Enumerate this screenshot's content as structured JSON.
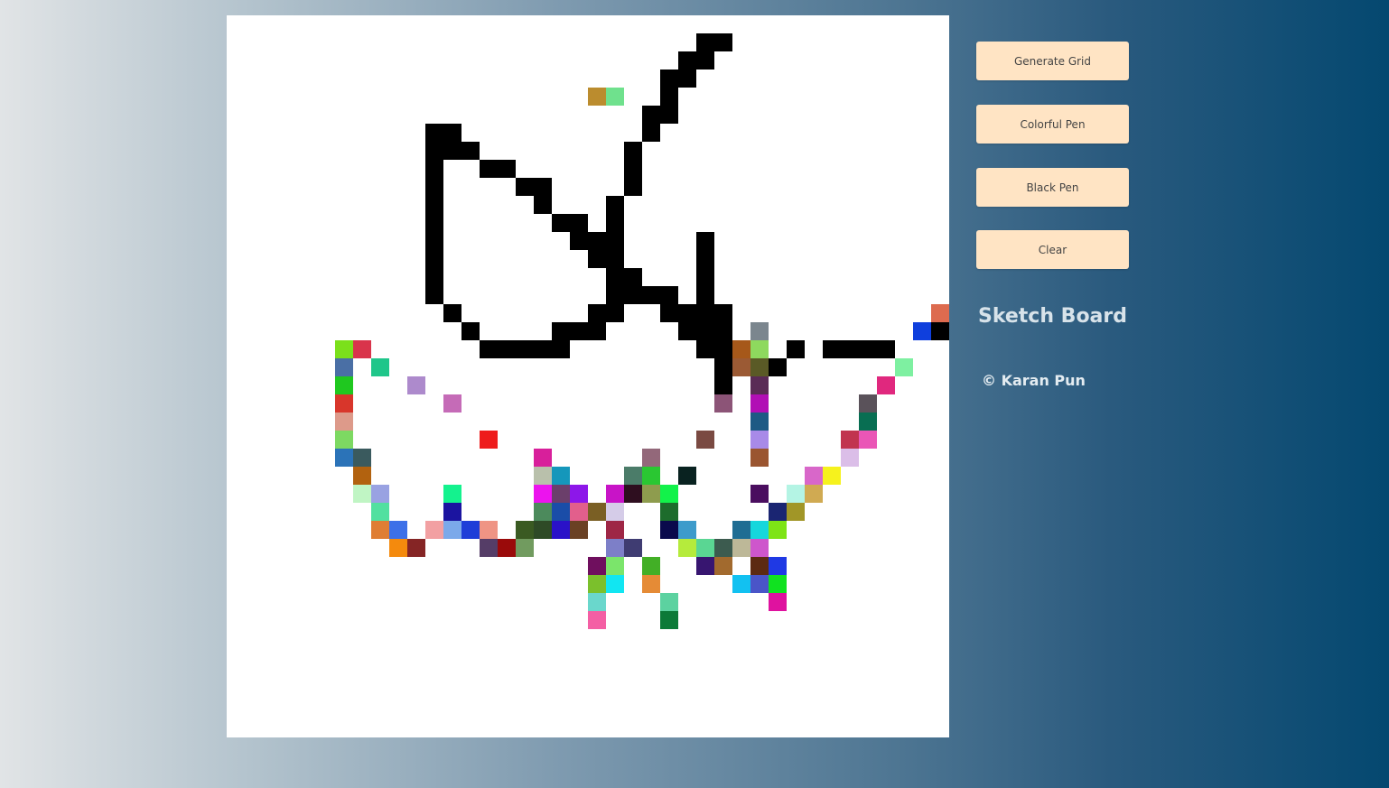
{
  "controls": {
    "generate_grid": "Generate Grid",
    "colorful_pen": "Colorful Pen",
    "black_pen": "Black Pen",
    "clear": "Clear"
  },
  "app": {
    "title": "Sketch Board",
    "credit": "© Karan Pun"
  },
  "board": {
    "background": "#ffffff",
    "grid_columns": 40,
    "grid_rows": 40,
    "black_pen_color": "#000000",
    "painted_cells": [
      {
        "r": 1,
        "c": 26,
        "color": "#000000"
      },
      {
        "r": 1,
        "c": 27,
        "color": "#000000"
      },
      {
        "r": 2,
        "c": 25,
        "color": "#000000"
      },
      {
        "r": 2,
        "c": 26,
        "color": "#000000"
      },
      {
        "r": 3,
        "c": 24,
        "color": "#000000"
      },
      {
        "r": 3,
        "c": 25,
        "color": "#000000"
      },
      {
        "r": 4,
        "c": 20,
        "color": "#bb8c2e"
      },
      {
        "r": 4,
        "c": 21,
        "color": "#6fe18d"
      },
      {
        "r": 4,
        "c": 24,
        "color": "#000000"
      },
      {
        "r": 5,
        "c": 23,
        "color": "#000000"
      },
      {
        "r": 5,
        "c": 24,
        "color": "#000000"
      },
      {
        "r": 6,
        "c": 11,
        "color": "#000000"
      },
      {
        "r": 6,
        "c": 12,
        "color": "#000000"
      },
      {
        "r": 6,
        "c": 23,
        "color": "#000000"
      },
      {
        "r": 7,
        "c": 11,
        "color": "#000000"
      },
      {
        "r": 7,
        "c": 12,
        "color": "#000000"
      },
      {
        "r": 7,
        "c": 13,
        "color": "#000000"
      },
      {
        "r": 7,
        "c": 22,
        "color": "#000000"
      },
      {
        "r": 8,
        "c": 11,
        "color": "#000000"
      },
      {
        "r": 8,
        "c": 14,
        "color": "#000000"
      },
      {
        "r": 8,
        "c": 15,
        "color": "#000000"
      },
      {
        "r": 8,
        "c": 22,
        "color": "#000000"
      },
      {
        "r": 9,
        "c": 11,
        "color": "#000000"
      },
      {
        "r": 9,
        "c": 16,
        "color": "#000000"
      },
      {
        "r": 9,
        "c": 17,
        "color": "#000000"
      },
      {
        "r": 9,
        "c": 22,
        "color": "#000000"
      },
      {
        "r": 10,
        "c": 11,
        "color": "#000000"
      },
      {
        "r": 10,
        "c": 17,
        "color": "#000000"
      },
      {
        "r": 10,
        "c": 21,
        "color": "#000000"
      },
      {
        "r": 11,
        "c": 11,
        "color": "#000000"
      },
      {
        "r": 11,
        "c": 18,
        "color": "#000000"
      },
      {
        "r": 11,
        "c": 19,
        "color": "#000000"
      },
      {
        "r": 11,
        "c": 21,
        "color": "#000000"
      },
      {
        "r": 12,
        "c": 11,
        "color": "#000000"
      },
      {
        "r": 12,
        "c": 19,
        "color": "#000000"
      },
      {
        "r": 12,
        "c": 20,
        "color": "#000000"
      },
      {
        "r": 12,
        "c": 21,
        "color": "#000000"
      },
      {
        "r": 12,
        "c": 26,
        "color": "#000000"
      },
      {
        "r": 13,
        "c": 11,
        "color": "#000000"
      },
      {
        "r": 13,
        "c": 20,
        "color": "#000000"
      },
      {
        "r": 13,
        "c": 21,
        "color": "#000000"
      },
      {
        "r": 13,
        "c": 26,
        "color": "#000000"
      },
      {
        "r": 14,
        "c": 11,
        "color": "#000000"
      },
      {
        "r": 14,
        "c": 21,
        "color": "#000000"
      },
      {
        "r": 14,
        "c": 22,
        "color": "#000000"
      },
      {
        "r": 14,
        "c": 26,
        "color": "#000000"
      },
      {
        "r": 15,
        "c": 11,
        "color": "#000000"
      },
      {
        "r": 15,
        "c": 21,
        "color": "#000000"
      },
      {
        "r": 15,
        "c": 22,
        "color": "#000000"
      },
      {
        "r": 15,
        "c": 23,
        "color": "#000000"
      },
      {
        "r": 15,
        "c": 24,
        "color": "#000000"
      },
      {
        "r": 15,
        "c": 26,
        "color": "#000000"
      },
      {
        "r": 16,
        "c": 12,
        "color": "#000000"
      },
      {
        "r": 16,
        "c": 20,
        "color": "#000000"
      },
      {
        "r": 16,
        "c": 21,
        "color": "#000000"
      },
      {
        "r": 16,
        "c": 24,
        "color": "#000000"
      },
      {
        "r": 16,
        "c": 25,
        "color": "#000000"
      },
      {
        "r": 16,
        "c": 26,
        "color": "#000000"
      },
      {
        "r": 16,
        "c": 27,
        "color": "#000000"
      },
      {
        "r": 16,
        "c": 39,
        "color": "#dd6b4f"
      },
      {
        "r": 17,
        "c": 13,
        "color": "#000000"
      },
      {
        "r": 17,
        "c": 18,
        "color": "#000000"
      },
      {
        "r": 17,
        "c": 19,
        "color": "#000000"
      },
      {
        "r": 17,
        "c": 20,
        "color": "#000000"
      },
      {
        "r": 17,
        "c": 25,
        "color": "#000000"
      },
      {
        "r": 17,
        "c": 26,
        "color": "#000000"
      },
      {
        "r": 17,
        "c": 27,
        "color": "#000000"
      },
      {
        "r": 17,
        "c": 29,
        "color": "#7b868e"
      },
      {
        "r": 17,
        "c": 38,
        "color": "#0f3fdd"
      },
      {
        "r": 17,
        "c": 39,
        "color": "#000000"
      },
      {
        "r": 18,
        "c": 6,
        "color": "#7be01b"
      },
      {
        "r": 18,
        "c": 7,
        "color": "#d9344b"
      },
      {
        "r": 18,
        "c": 14,
        "color": "#000000"
      },
      {
        "r": 18,
        "c": 15,
        "color": "#000000"
      },
      {
        "r": 18,
        "c": 16,
        "color": "#000000"
      },
      {
        "r": 18,
        "c": 17,
        "color": "#000000"
      },
      {
        "r": 18,
        "c": 18,
        "color": "#000000"
      },
      {
        "r": 18,
        "c": 26,
        "color": "#000000"
      },
      {
        "r": 18,
        "c": 27,
        "color": "#000000"
      },
      {
        "r": 18,
        "c": 28,
        "color": "#a6581a"
      },
      {
        "r": 18,
        "c": 29,
        "color": "#8ed95e"
      },
      {
        "r": 18,
        "c": 31,
        "color": "#000000"
      },
      {
        "r": 18,
        "c": 33,
        "color": "#000000"
      },
      {
        "r": 18,
        "c": 34,
        "color": "#000000"
      },
      {
        "r": 18,
        "c": 35,
        "color": "#000000"
      },
      {
        "r": 18,
        "c": 36,
        "color": "#000000"
      },
      {
        "r": 19,
        "c": 6,
        "color": "#4a6fa5"
      },
      {
        "r": 19,
        "c": 8,
        "color": "#1fc68a"
      },
      {
        "r": 19,
        "c": 27,
        "color": "#000000"
      },
      {
        "r": 19,
        "c": 28,
        "color": "#9b5a34"
      },
      {
        "r": 19,
        "c": 29,
        "color": "#5a5a26"
      },
      {
        "r": 19,
        "c": 30,
        "color": "#000000"
      },
      {
        "r": 19,
        "c": 37,
        "color": "#7ef0a1"
      },
      {
        "r": 20,
        "c": 6,
        "color": "#1fc81f"
      },
      {
        "r": 20,
        "c": 10,
        "color": "#ad8acc"
      },
      {
        "r": 20,
        "c": 27,
        "color": "#000000"
      },
      {
        "r": 20,
        "c": 29,
        "color": "#5a2c56"
      },
      {
        "r": 20,
        "c": 36,
        "color": "#e0287e"
      },
      {
        "r": 21,
        "c": 6,
        "color": "#d8362b"
      },
      {
        "r": 21,
        "c": 12,
        "color": "#c56bb7"
      },
      {
        "r": 21,
        "c": 27,
        "color": "#8c5477"
      },
      {
        "r": 21,
        "c": 29,
        "color": "#b10fb5"
      },
      {
        "r": 21,
        "c": 35,
        "color": "#5a525a"
      },
      {
        "r": 22,
        "c": 6,
        "color": "#dd9a8a"
      },
      {
        "r": 22,
        "c": 29,
        "color": "#1d5a84"
      },
      {
        "r": 22,
        "c": 35,
        "color": "#086e52"
      },
      {
        "r": 23,
        "c": 6,
        "color": "#7dd962"
      },
      {
        "r": 23,
        "c": 14,
        "color": "#ee1c1c"
      },
      {
        "r": 23,
        "c": 26,
        "color": "#7a4a42"
      },
      {
        "r": 23,
        "c": 29,
        "color": "#a88ae8"
      },
      {
        "r": 23,
        "c": 34,
        "color": "#c1344f"
      },
      {
        "r": 23,
        "c": 35,
        "color": "#ea56b6"
      },
      {
        "r": 24,
        "c": 6,
        "color": "#2b73b8"
      },
      {
        "r": 24,
        "c": 7,
        "color": "#3a5a5e"
      },
      {
        "r": 24,
        "c": 17,
        "color": "#d81f9b"
      },
      {
        "r": 24,
        "c": 23,
        "color": "#93687a"
      },
      {
        "r": 24,
        "c": 29,
        "color": "#9a5530"
      },
      {
        "r": 24,
        "c": 34,
        "color": "#dbbee8"
      },
      {
        "r": 25,
        "c": 7,
        "color": "#b2620f"
      },
      {
        "r": 25,
        "c": 17,
        "color": "#b9c0ab"
      },
      {
        "r": 25,
        "c": 18,
        "color": "#1597bb"
      },
      {
        "r": 25,
        "c": 22,
        "color": "#4b7c69"
      },
      {
        "r": 25,
        "c": 23,
        "color": "#2ac732"
      },
      {
        "r": 25,
        "c": 25,
        "color": "#092220"
      },
      {
        "r": 25,
        "c": 32,
        "color": "#d867c9"
      },
      {
        "r": 25,
        "c": 33,
        "color": "#f6f21d"
      },
      {
        "r": 26,
        "c": 7,
        "color": "#c0f5c4"
      },
      {
        "r": 26,
        "c": 8,
        "color": "#99a2e2"
      },
      {
        "r": 26,
        "c": 12,
        "color": "#14f28e"
      },
      {
        "r": 26,
        "c": 17,
        "color": "#ec13ee"
      },
      {
        "r": 26,
        "c": 18,
        "color": "#6b3f6b"
      },
      {
        "r": 26,
        "c": 19,
        "color": "#8d17e9"
      },
      {
        "r": 26,
        "c": 21,
        "color": "#c814c7"
      },
      {
        "r": 26,
        "c": 22,
        "color": "#2e0e1f"
      },
      {
        "r": 26,
        "c": 23,
        "color": "#8e9c4e"
      },
      {
        "r": 26,
        "c": 24,
        "color": "#12f24a"
      },
      {
        "r": 26,
        "c": 29,
        "color": "#4a0e5f"
      },
      {
        "r": 26,
        "c": 31,
        "color": "#b4f4e4"
      },
      {
        "r": 26,
        "c": 32,
        "color": "#d0aa52"
      },
      {
        "r": 27,
        "c": 8,
        "color": "#52e0a0"
      },
      {
        "r": 27,
        "c": 12,
        "color": "#1b14a0"
      },
      {
        "r": 27,
        "c": 17,
        "color": "#4c8a5c"
      },
      {
        "r": 27,
        "c": 18,
        "color": "#1a4da8"
      },
      {
        "r": 27,
        "c": 19,
        "color": "#e25f8c"
      },
      {
        "r": 27,
        "c": 20,
        "color": "#7a5f24"
      },
      {
        "r": 27,
        "c": 21,
        "color": "#d5cce8"
      },
      {
        "r": 27,
        "c": 24,
        "color": "#1d6c2c"
      },
      {
        "r": 27,
        "c": 30,
        "color": "#1a2572"
      },
      {
        "r": 27,
        "c": 31,
        "color": "#a19627"
      },
      {
        "r": 28,
        "c": 8,
        "color": "#df7e34"
      },
      {
        "r": 28,
        "c": 9,
        "color": "#3d70e8"
      },
      {
        "r": 28,
        "c": 11,
        "color": "#f2a0a2"
      },
      {
        "r": 28,
        "c": 12,
        "color": "#7ba9ea"
      },
      {
        "r": 28,
        "c": 13,
        "color": "#1f3ed8"
      },
      {
        "r": 28,
        "c": 14,
        "color": "#ef9484"
      },
      {
        "r": 28,
        "c": 16,
        "color": "#3a5a22"
      },
      {
        "r": 28,
        "c": 17,
        "color": "#2e4a26"
      },
      {
        "r": 28,
        "c": 18,
        "color": "#2a12c8"
      },
      {
        "r": 28,
        "c": 19,
        "color": "#6a4124"
      },
      {
        "r": 28,
        "c": 21,
        "color": "#9e2645"
      },
      {
        "r": 28,
        "c": 24,
        "color": "#0a0a4c"
      },
      {
        "r": 28,
        "c": 25,
        "color": "#3d9bcb"
      },
      {
        "r": 28,
        "c": 28,
        "color": "#1f6d93"
      },
      {
        "r": 28,
        "c": 29,
        "color": "#16d7dc"
      },
      {
        "r": 28,
        "c": 30,
        "color": "#7ee416"
      },
      {
        "r": 29,
        "c": 9,
        "color": "#f48a0d"
      },
      {
        "r": 29,
        "c": 10,
        "color": "#852525"
      },
      {
        "r": 29,
        "c": 14,
        "color": "#553d67"
      },
      {
        "r": 29,
        "c": 15,
        "color": "#9a0a0a"
      },
      {
        "r": 29,
        "c": 16,
        "color": "#719b5f"
      },
      {
        "r": 29,
        "c": 21,
        "color": "#7d7fc8"
      },
      {
        "r": 29,
        "c": 22,
        "color": "#3f3c72"
      },
      {
        "r": 29,
        "c": 25,
        "color": "#b5eb3c"
      },
      {
        "r": 29,
        "c": 26,
        "color": "#5ad693"
      },
      {
        "r": 29,
        "c": 27,
        "color": "#3c5b4f"
      },
      {
        "r": 29,
        "c": 28,
        "color": "#bdb898"
      },
      {
        "r": 29,
        "c": 29,
        "color": "#ce56cc"
      },
      {
        "r": 30,
        "c": 20,
        "color": "#6f0f5e"
      },
      {
        "r": 30,
        "c": 21,
        "color": "#7be56b"
      },
      {
        "r": 30,
        "c": 23,
        "color": "#42af26"
      },
      {
        "r": 30,
        "c": 26,
        "color": "#371570"
      },
      {
        "r": 30,
        "c": 27,
        "color": "#a26a2e"
      },
      {
        "r": 30,
        "c": 29,
        "color": "#5c2a12"
      },
      {
        "r": 30,
        "c": 30,
        "color": "#1f39e4"
      },
      {
        "r": 31,
        "c": 20,
        "color": "#7bc02c"
      },
      {
        "r": 31,
        "c": 21,
        "color": "#11e6f2"
      },
      {
        "r": 31,
        "c": 23,
        "color": "#e58b36"
      },
      {
        "r": 31,
        "c": 28,
        "color": "#12c1f1"
      },
      {
        "r": 31,
        "c": 29,
        "color": "#4a55c8"
      },
      {
        "r": 31,
        "c": 30,
        "color": "#10e220"
      },
      {
        "r": 32,
        "c": 20,
        "color": "#6ad7cc"
      },
      {
        "r": 32,
        "c": 24,
        "color": "#5cd2a0"
      },
      {
        "r": 32,
        "c": 30,
        "color": "#df129f"
      },
      {
        "r": 33,
        "c": 20,
        "color": "#f45fa4"
      },
      {
        "r": 33,
        "c": 24,
        "color": "#0c7a38"
      }
    ]
  }
}
